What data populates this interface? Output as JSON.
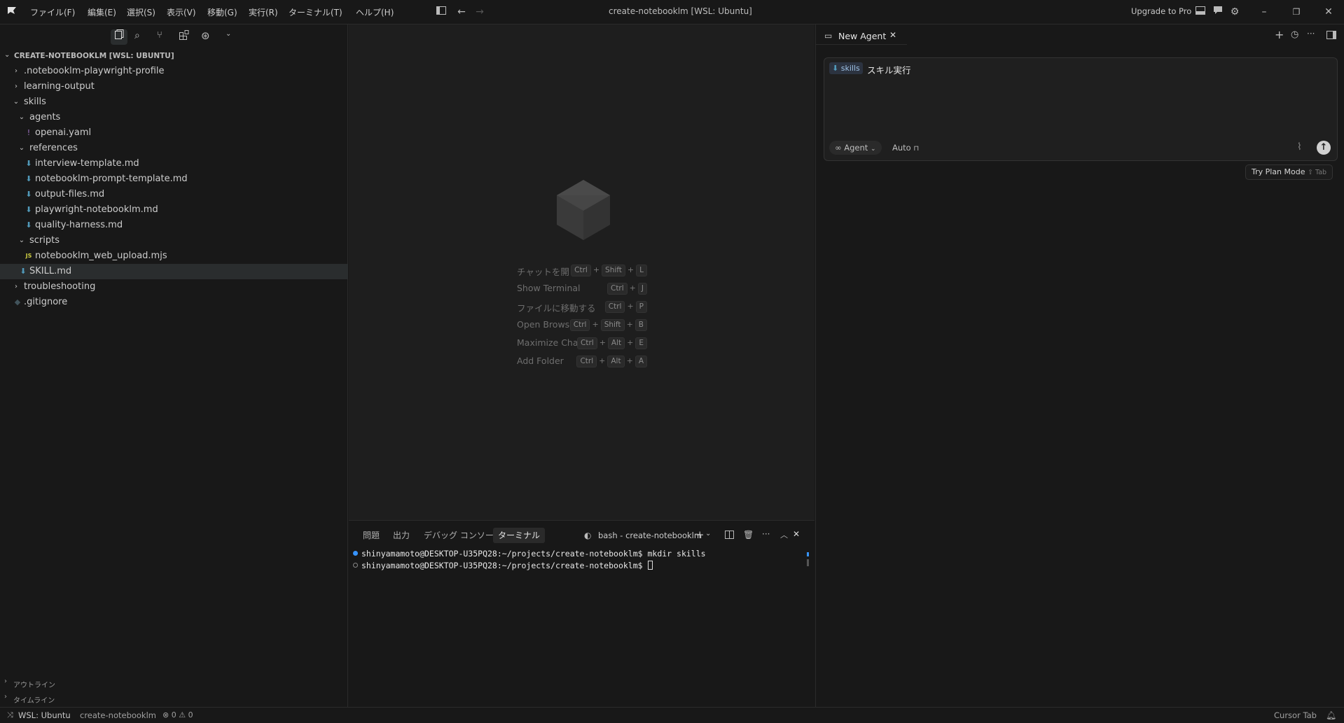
{
  "titlebar": {
    "menus": [
      "ファイル(F)",
      "編集(E)",
      "選択(S)",
      "表示(V)",
      "移動(G)",
      "実行(R)",
      "ターミナル(T)",
      "ヘルプ(H)"
    ],
    "window_title": "create-notebooklm [WSL: Ubuntu]",
    "upgrade_label": "Upgrade to Pro"
  },
  "explorer": {
    "root_label": "CREATE-NOTEBOOKLM [WSL: UBUNTU]",
    "items": [
      {
        "label": ".notebooklm-playwright-profile",
        "kind": "folder",
        "expanded": false,
        "depth": 0
      },
      {
        "label": "learning-output",
        "kind": "folder",
        "expanded": false,
        "depth": 0
      },
      {
        "label": "skills",
        "kind": "folder",
        "expanded": true,
        "depth": 0
      },
      {
        "label": "agents",
        "kind": "folder",
        "expanded": true,
        "depth": 1
      },
      {
        "label": "openai.yaml",
        "kind": "yaml",
        "depth": 2
      },
      {
        "label": "references",
        "kind": "folder",
        "expanded": true,
        "depth": 1
      },
      {
        "label": "interview-template.md",
        "kind": "md",
        "depth": 2
      },
      {
        "label": "notebooklm-prompt-template.md",
        "kind": "md",
        "depth": 2
      },
      {
        "label": "output-files.md",
        "kind": "md",
        "depth": 2
      },
      {
        "label": "playwright-notebooklm.md",
        "kind": "md",
        "depth": 2
      },
      {
        "label": "quality-harness.md",
        "kind": "md",
        "depth": 2
      },
      {
        "label": "scripts",
        "kind": "folder",
        "expanded": true,
        "depth": 1
      },
      {
        "label": "notebooklm_web_upload.mjs",
        "kind": "js",
        "depth": 2
      },
      {
        "label": "SKILL.md",
        "kind": "md",
        "depth": 1,
        "selected": true
      },
      {
        "label": "troubleshooting",
        "kind": "folder",
        "expanded": false,
        "depth": 0
      },
      {
        "label": ".gitignore",
        "kind": "git",
        "depth": 0
      }
    ],
    "outline_label": "アウトライン",
    "timeline_label": "タイムライン"
  },
  "editor_welcome": {
    "shortcuts": [
      {
        "label": "チャットを開く",
        "keys": [
          "Ctrl",
          "Shift",
          "L"
        ]
      },
      {
        "label": "Show Terminal",
        "keys": [
          "Ctrl",
          "J"
        ]
      },
      {
        "label": "ファイルに移動する",
        "keys": [
          "Ctrl",
          "P"
        ]
      },
      {
        "label": "Open Browser",
        "keys": [
          "Ctrl",
          "Shift",
          "B"
        ]
      },
      {
        "label": "Maximize Chat",
        "keys": [
          "Ctrl",
          "Alt",
          "E"
        ]
      },
      {
        "label": "Add Folder",
        "keys": [
          "Ctrl",
          "Alt",
          "A"
        ]
      }
    ]
  },
  "panel": {
    "tabs": [
      "問題",
      "出力",
      "デバッグ コンソール",
      "ターミナル"
    ],
    "active_tab": "ターミナル",
    "terminal_name": "bash - create-notebooklm",
    "lines": [
      "shinyamamoto@DESKTOP-U35PQ28:~/projects/create-notebooklm$ mkdir skills",
      "shinyamamoto@DESKTOP-U35PQ28:~/projects/create-notebooklm$ "
    ]
  },
  "chat": {
    "tab_label": "New Agent",
    "chip_label": "skills",
    "input_text": "スキル実行",
    "mode_label": "Agent",
    "model_label": "Auto",
    "plan_button_label": "Try Plan Mode",
    "plan_button_hint": "⇧ Tab"
  },
  "statusbar": {
    "remote_label": "WSL: Ubuntu",
    "folder_label": "create-notebooklm",
    "errors": "0",
    "warnings": "0",
    "cursor_tab_label": "Cursor Tab"
  },
  "colors": {
    "background": "#181818",
    "editor_bg": "#1e1e1e",
    "markdown_icon": "#519aba",
    "js_icon": "#cbcb41",
    "yaml_icon": "#a074c4",
    "accent_blue": "#3794ff"
  }
}
